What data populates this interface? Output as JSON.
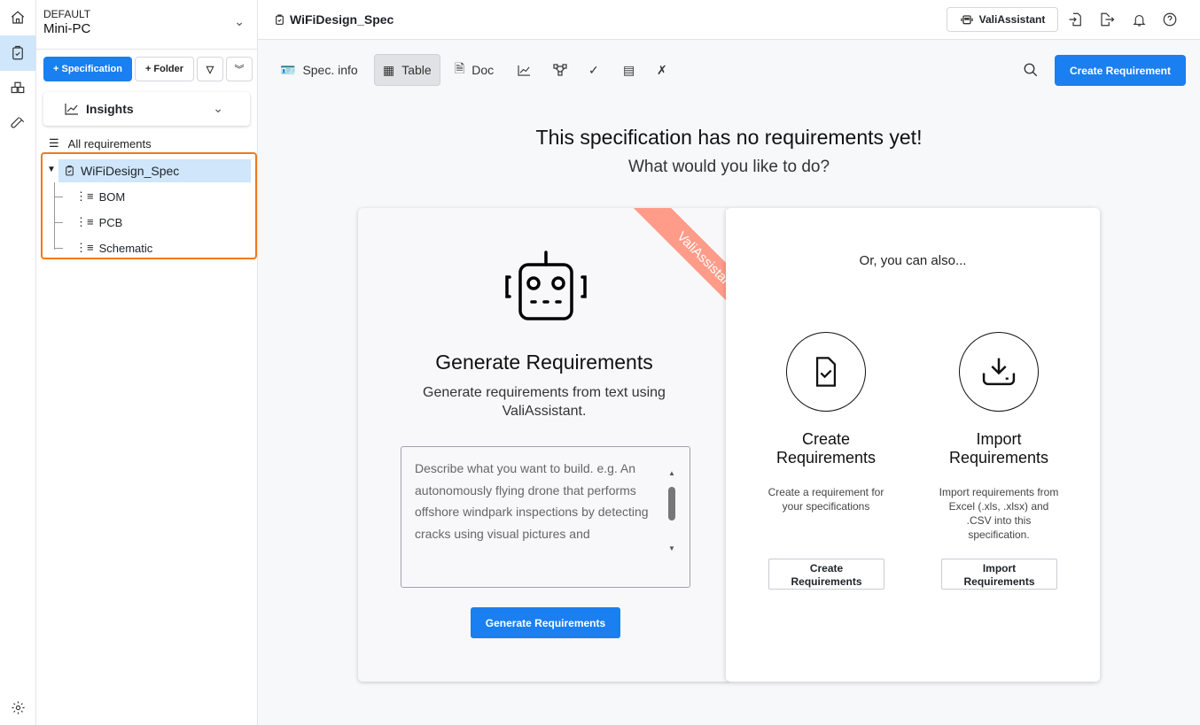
{
  "rail": {
    "items": [
      "home-icon",
      "specification-icon",
      "components-icon",
      "test-icon"
    ],
    "settings": "gear-icon"
  },
  "sidebar": {
    "workspace": "DEFAULT",
    "project": "Mini-PC",
    "add_spec": "+ Specification",
    "add_folder": "+ Folder",
    "insights": "Insights",
    "all_requirements": "All requirements",
    "tree": {
      "root": "WiFiDesign_Spec",
      "children": [
        "BOM",
        "PCB",
        "Schematic"
      ]
    }
  },
  "header": {
    "title": "WiFiDesign_Spec",
    "assistant": "ValiAssistant"
  },
  "toolbar": {
    "tabs": [
      "Spec. info",
      "Table",
      "Doc"
    ],
    "active": "Table",
    "create": "Create Requirement"
  },
  "empty": {
    "title": "This specification has no requirements yet!",
    "subtitle": "What would you like to do?"
  },
  "generate": {
    "ribbon": "ValiAssistant",
    "title": "Generate Requirements",
    "desc1": "Generate requirements from text using",
    "desc2": "ValiAssistant.",
    "placeholder": "Describe what you want to build. e.g. An autonomously flying drone that performs offshore windpark inspections by detecting cracks using visual pictures and",
    "button": "Generate Requirements"
  },
  "alt": {
    "heading": "Or, you can also...",
    "create": {
      "title1": "Create",
      "title2": "Requirements",
      "desc": "Create a requirement for your specifications",
      "button1": "Create",
      "button2": "Requirements"
    },
    "import": {
      "title1": "Import",
      "title2": "Requirements",
      "desc": "Import requirements from Excel (.xls, .xlsx) and .CSV into this specification.",
      "button1": "Import",
      "button2": "Requirements"
    }
  },
  "colors": {
    "accent": "#1a7ff0",
    "highlight": "#f07a1c",
    "ribbon": "#fe9c89",
    "selected": "#cfe6fb"
  }
}
